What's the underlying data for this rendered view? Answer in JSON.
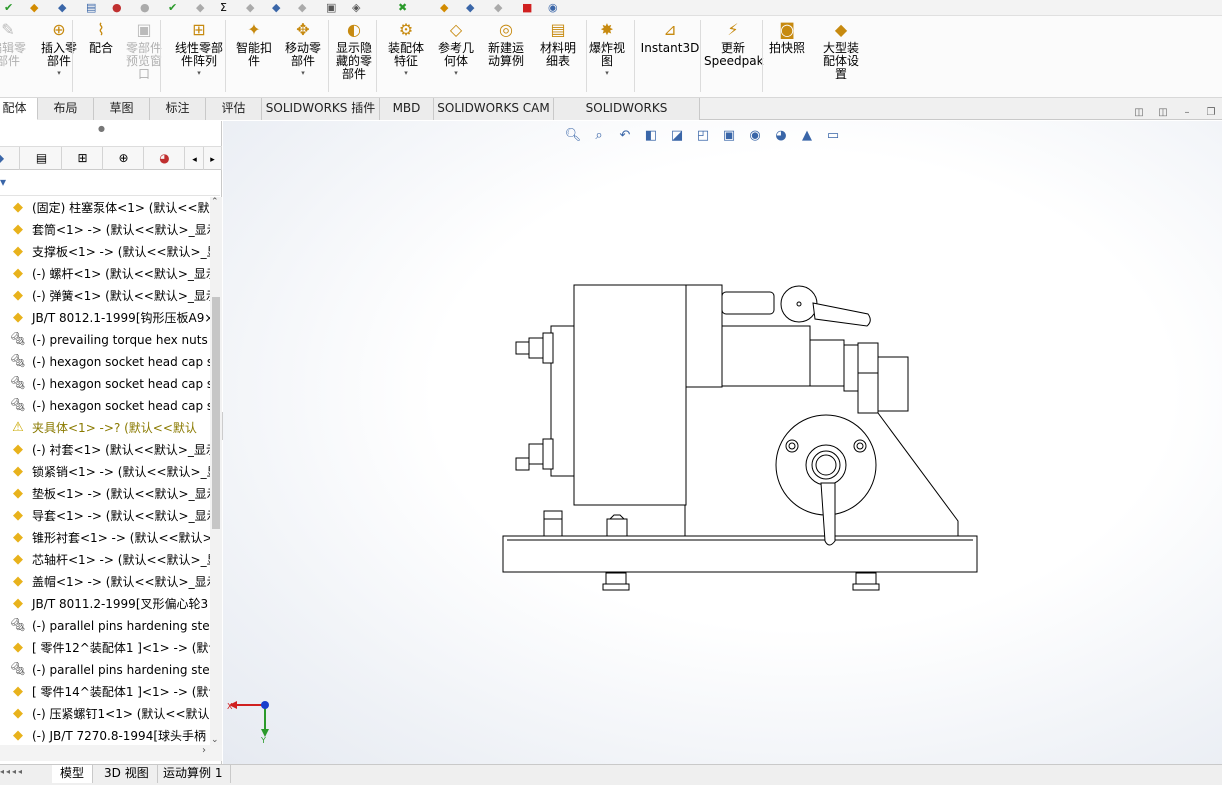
{
  "ribbon": {
    "buttons": [
      {
        "id": "edit-component",
        "label": "编辑零\n部件",
        "disabled": true
      },
      {
        "id": "insert-component",
        "label": "插入零\n部件",
        "disabled": false,
        "arrow": true
      },
      {
        "id": "mate",
        "label": "配合",
        "disabled": false
      },
      {
        "id": "component-preview",
        "label": "零部件\n预览窗\n口",
        "disabled": true
      },
      {
        "id": "linear-pattern",
        "label": "线性零部\n件阵列",
        "disabled": false,
        "arrow": true
      },
      {
        "id": "smart-fasteners",
        "label": "智能扣\n件",
        "disabled": false
      },
      {
        "id": "move-component",
        "label": "移动零\n部件",
        "disabled": false,
        "arrow": true
      },
      {
        "id": "show-hidden",
        "label": "显示隐\n藏的零\n部件",
        "disabled": false
      },
      {
        "id": "assembly-features",
        "label": "装配体\n特征",
        "disabled": false,
        "arrow": true
      },
      {
        "id": "reference-geometry",
        "label": "参考几\n何体",
        "disabled": false,
        "arrow": true
      },
      {
        "id": "new-motion-study",
        "label": "新建运\n动算例",
        "disabled": false
      },
      {
        "id": "bom",
        "label": "材料明\n细表",
        "disabled": false
      },
      {
        "id": "exploded-view",
        "label": "爆炸视\n图",
        "disabled": false,
        "arrow": true
      },
      {
        "id": "instant3d",
        "label": "Instant3D",
        "disabled": false
      },
      {
        "id": "update-speedpak",
        "label": "更新\nSpeedpak",
        "disabled": false
      },
      {
        "id": "take-snapshot",
        "label": "拍快照",
        "disabled": false
      },
      {
        "id": "large-assembly",
        "label": "大型装\n配体设\n置",
        "disabled": false
      }
    ]
  },
  "tabs": [
    {
      "label": "配体",
      "active": true
    },
    {
      "label": "布局",
      "active": false
    },
    {
      "label": "草图",
      "active": false
    },
    {
      "label": "标注",
      "active": false
    },
    {
      "label": "评估",
      "active": false
    },
    {
      "label": "SOLIDWORKS 插件",
      "active": false
    },
    {
      "label": "MBD",
      "active": false
    },
    {
      "label": "SOLIDWORKS CAM",
      "active": false
    },
    {
      "label": "SOLIDWORKS Inspection",
      "active": false
    }
  ],
  "tree": {
    "items": [
      {
        "text": "(固定) 柱塞泵体<1> (默认<<默认",
        "icon": "part"
      },
      {
        "text": "套筒<1> -> (默认<<默认>_显示",
        "icon": "part"
      },
      {
        "text": "支撑板<1> -> (默认<<默认>_显",
        "icon": "part"
      },
      {
        "text": "(-) 螺杆<1> (默认<<默认>_显示",
        "icon": "part"
      },
      {
        "text": "(-) 弹簧<1> (默认<<默认>_显示",
        "icon": "part"
      },
      {
        "text": "JB/T 8012.1-1999[钩形压板A9×",
        "icon": "part"
      },
      {
        "text": "(-) prevailing torque hex nuts",
        "icon": "toolbox"
      },
      {
        "text": "(-) hexagon socket head cap s",
        "icon": "toolbox"
      },
      {
        "text": "(-) hexagon socket head cap s",
        "icon": "toolbox"
      },
      {
        "text": "(-) hexagon socket head cap s",
        "icon": "toolbox"
      },
      {
        "text": "夹具体<1> ->? (默认<<默认",
        "icon": "warning",
        "warn": true
      },
      {
        "text": "(-) 衬套<1> (默认<<默认>_显示",
        "icon": "part"
      },
      {
        "text": "锁紧销<1> -> (默认<<默认>_显",
        "icon": "part"
      },
      {
        "text": "垫板<1> -> (默认<<默认>_显示",
        "icon": "part"
      },
      {
        "text": "导套<1> -> (默认<<默认>_显示",
        "icon": "part"
      },
      {
        "text": "锥形衬套<1> -> (默认<<默认>",
        "icon": "part"
      },
      {
        "text": "芯轴杆<1> -> (默认<<默认>_显",
        "icon": "part"
      },
      {
        "text": "盖帽<1> -> (默认<<默认>_显示",
        "icon": "part"
      },
      {
        "text": "JB/T 8011.2-1999[叉形偏心轮3",
        "icon": "part"
      },
      {
        "text": "(-) parallel pins hardening ste",
        "icon": "toolbox"
      },
      {
        "text": "[ 零件12^装配体1 ]<1> -> (默认",
        "icon": "part"
      },
      {
        "text": "(-) parallel pins hardening ste",
        "icon": "toolbox"
      },
      {
        "text": "[ 零件14^装配体1 ]<1> -> (默认",
        "icon": "part"
      },
      {
        "text": "(-) 压紧螺钉1<1> (默认<<默认>",
        "icon": "part"
      },
      {
        "text": "(-) JB/T 7270.8-1994[球头手柄",
        "icon": "part"
      }
    ]
  },
  "triad": {
    "x_label": "X",
    "y_label": "Y"
  },
  "bottom_tabs": [
    {
      "label": "模型",
      "active": true
    },
    {
      "label": "3D 视图",
      "active": false
    },
    {
      "label": "运动算例 1",
      "active": false
    }
  ],
  "colors": {
    "accent": "#2f5fa8",
    "part_icon": "#e8b21c",
    "warning": "#e0c000",
    "triad_x": "#d02020",
    "triad_y": "#2a9a2a",
    "triad_z": "#1a3fcc"
  }
}
